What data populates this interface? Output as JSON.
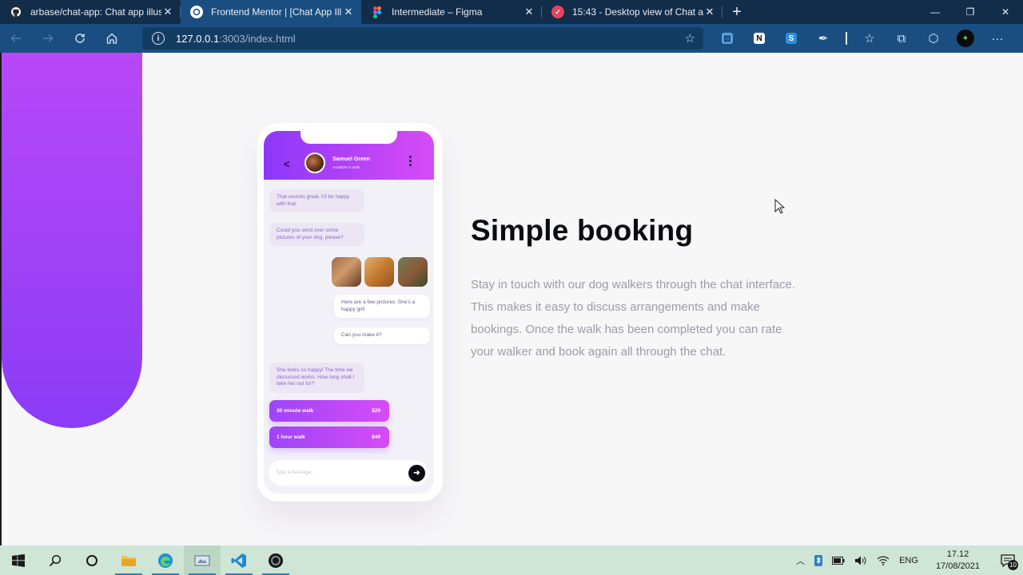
{
  "browser": {
    "tabs": [
      {
        "title": "arbase/chat-app: Chat app illustr",
        "active": false,
        "icon": "github-icon"
      },
      {
        "title": "Frontend Mentor | [Chat App Illu",
        "active": true,
        "icon": "frontend-mentor-icon"
      },
      {
        "title": "Intermediate – Figma",
        "active": false,
        "icon": "figma-icon"
      },
      {
        "title": "15:43 - Desktop view of Chat ap",
        "active": false,
        "icon": "check-icon"
      }
    ],
    "close_glyph": "✕",
    "new_tab_glyph": "+",
    "window_controls": {
      "minimize": "—",
      "restore": "❐",
      "close": "✕"
    },
    "url": {
      "host": "127.0.0.1",
      "path": ":3003/index.html"
    }
  },
  "chat": {
    "contact_name": "Samuel Green",
    "contact_status": "Available to Walk",
    "messages": [
      {
        "text": "That sounds great. I'd be happy with that.",
        "from": "walker"
      },
      {
        "text": "Could you send over some pictures of your dog, please?",
        "from": "walker"
      },
      {
        "text": "Here are a few pictures. She's a happy girl!",
        "from": "owner"
      },
      {
        "text": "Can you make it?",
        "from": "owner"
      },
      {
        "text": "She looks so happy! The time we discussed works. How long shall I take her out for?",
        "from": "walker"
      }
    ],
    "offers": [
      {
        "label": "30 minute walk",
        "price": "$29"
      },
      {
        "label": "1 hour walk",
        "price": "$49"
      }
    ],
    "input_placeholder": "Type a message…",
    "send_glyph": "➜"
  },
  "content": {
    "headline": "Simple booking",
    "body": "Stay in touch with our dog walkers through the chat interface. This makes it easy to discuss arrangements and make bookings. Once the walk has been completed you can rate your walker and book again all through the chat."
  },
  "taskbar": {
    "language": "ENG",
    "time": "17.12",
    "date": "17/08/2021",
    "notification_count": "10"
  },
  "colors": {
    "tabstrip": "#112d4a",
    "toolbar": "#1a4e80",
    "gradient_start": "#8c38f8",
    "gradient_end": "#d84bf6",
    "headline": "#0b0b12",
    "body_text": "#a09ba8",
    "taskbar": "#cfe6d6"
  }
}
